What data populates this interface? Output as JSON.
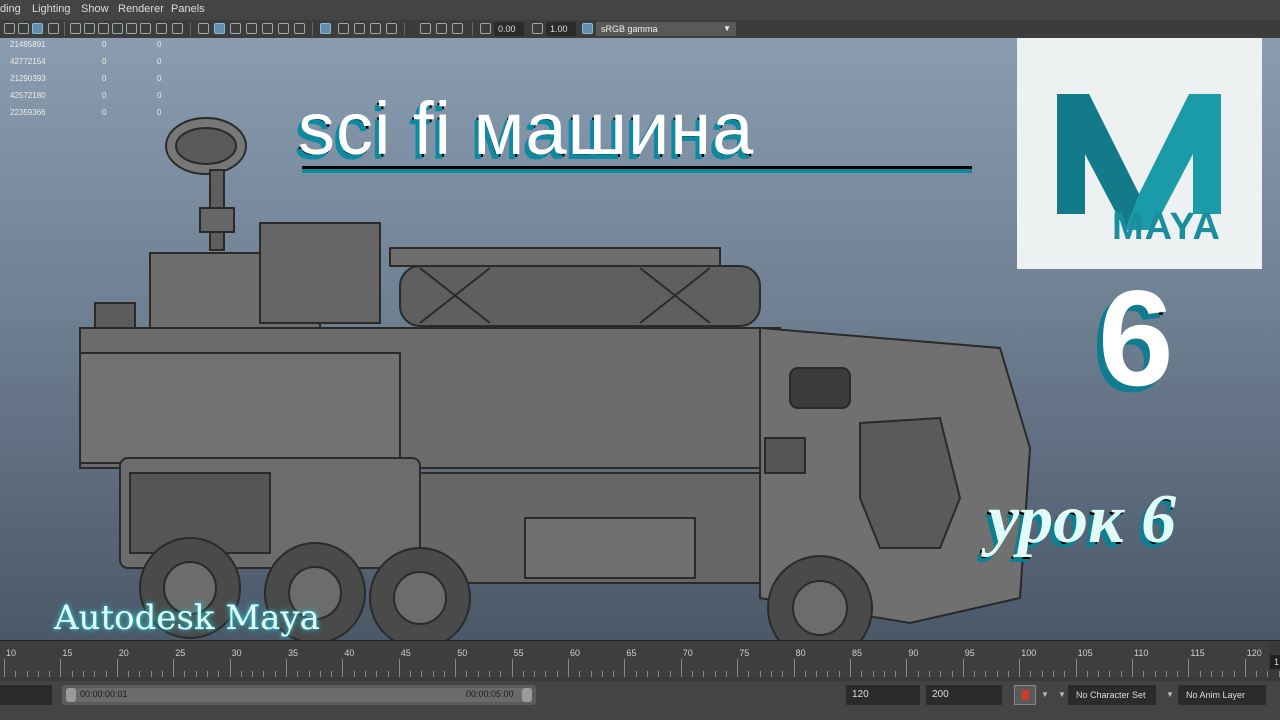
{
  "menu": [
    "ding",
    "Lighting",
    "Show",
    "Renderer",
    "Panels"
  ],
  "toolbar": {
    "exposure": "0.00",
    "gamma_value": "1.00",
    "color_space": "sRGB gamma"
  },
  "hud": [
    {
      "a": "21485891",
      "b": "0",
      "c": "0"
    },
    {
      "a": "42772154",
      "b": "0",
      "c": "0"
    },
    {
      "a": "21290393",
      "b": "0",
      "c": "0"
    },
    {
      "a": "42572180",
      "b": "0",
      "c": "0"
    },
    {
      "a": "22359366",
      "b": "0",
      "c": "0"
    }
  ],
  "overlay": {
    "title": "sci fi машина",
    "logo_word": "MAYA",
    "number": "6",
    "lesson": "урок 6",
    "brand": "Autodesk Maya"
  },
  "timeline": {
    "ticks": [
      "10",
      "15",
      "20",
      "25",
      "30",
      "35",
      "40",
      "45",
      "50",
      "55",
      "60",
      "65",
      "70",
      "75",
      "80",
      "85",
      "90",
      "95",
      "100",
      "105",
      "110",
      "115",
      "120"
    ],
    "current": "1"
  },
  "range": {
    "start_time": "00:00:00:01",
    "end_time": "00:00:05:00",
    "end_frame": "120",
    "max_frame": "200",
    "character_set": "No Character Set",
    "anim_layer": "No Anim Layer"
  },
  "colors": {
    "accent": "#0d8aa0",
    "menu_bg": "#444444",
    "viewport_top": "#8a9cb0",
    "viewport_bottom": "#4b5868"
  }
}
